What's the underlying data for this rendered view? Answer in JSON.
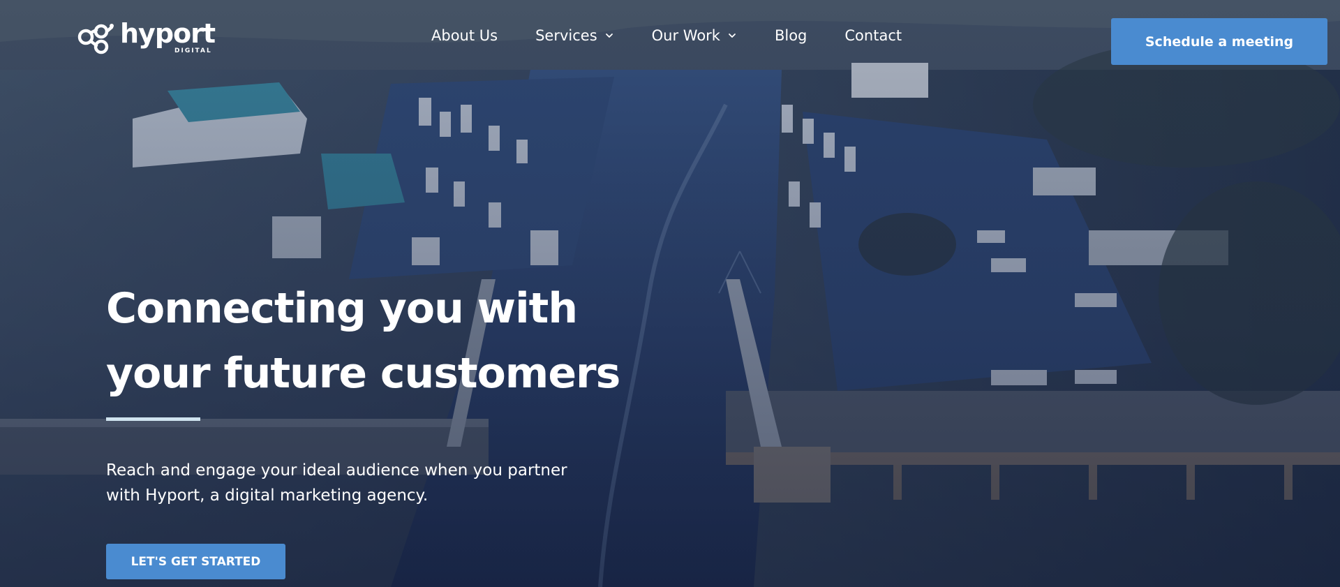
{
  "brand": {
    "name": "hyport",
    "subtitle": "DIGITAL",
    "logo_icon": "hyport-logo-icon"
  },
  "nav": {
    "items": [
      {
        "label": "About Us",
        "has_dropdown": false
      },
      {
        "label": "Services",
        "has_dropdown": true
      },
      {
        "label": "Our Work",
        "has_dropdown": true
      },
      {
        "label": "Blog",
        "has_dropdown": false
      },
      {
        "label": "Contact",
        "has_dropdown": false
      }
    ],
    "dropdown_icon": "chevron-down-icon"
  },
  "header_cta": {
    "label": "Schedule a meeting"
  },
  "hero": {
    "headline_line1": "Connecting you with",
    "headline_line2": "your future customers",
    "subtext_line1": "Reach and engage your ideal audience when you partner",
    "subtext_line2": "with Hyport, a digital marketing agency.",
    "cta_label": "LET'S GET STARTED",
    "background": "aerial marina photo"
  },
  "colors": {
    "accent": "#4a8bd0",
    "headline_rule": "#cfe3ef",
    "overlay": "#1e2c4e"
  }
}
